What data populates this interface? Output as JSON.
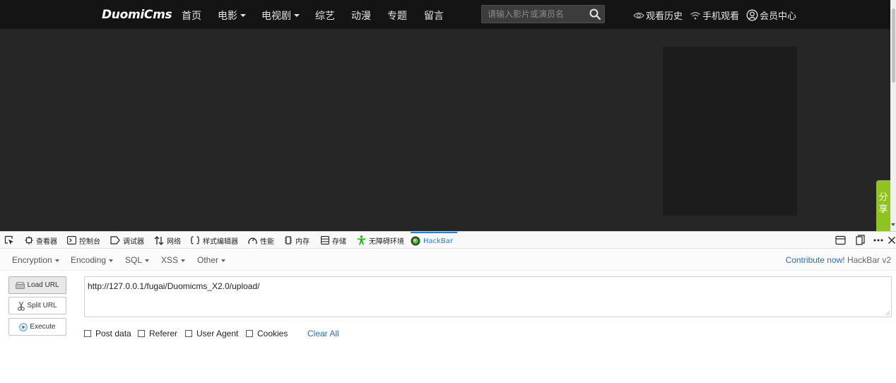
{
  "site": {
    "logo": "DuomiCms",
    "nav": [
      {
        "label": "首页",
        "dropdown": false
      },
      {
        "label": "电影",
        "dropdown": true
      },
      {
        "label": "电视剧",
        "dropdown": true
      },
      {
        "label": "综艺",
        "dropdown": false
      },
      {
        "label": "动漫",
        "dropdown": false
      },
      {
        "label": "专题",
        "dropdown": false
      },
      {
        "label": "留言",
        "dropdown": false
      }
    ],
    "search": {
      "placeholder": "请输入影片或演员名",
      "icon": "search-icon"
    },
    "right_links": [
      {
        "label": "观看历史",
        "icon": "eye-icon"
      },
      {
        "label": "手机观看",
        "icon": "wifi-icon"
      },
      {
        "label": "会员中心",
        "icon": "user-icon"
      }
    ],
    "share": {
      "label_1": "分",
      "label_2": "享"
    },
    "colors": {
      "topbar": "#141414",
      "body": "#262626",
      "share": "#8fc31f"
    }
  },
  "devtools": {
    "tabs": [
      {
        "label": "",
        "icon": "inspector-pick-icon"
      },
      {
        "label": "查看器",
        "icon": "inspector-icon"
      },
      {
        "label": "控制台",
        "icon": "console-icon"
      },
      {
        "label": "调试器",
        "icon": "debugger-icon"
      },
      {
        "label": "网络",
        "icon": "network-icon"
      },
      {
        "label": "样式编辑器",
        "icon": "style-editor-icon"
      },
      {
        "label": "性能",
        "icon": "performance-icon"
      },
      {
        "label": "内存",
        "icon": "memory-icon"
      },
      {
        "label": "存储",
        "icon": "storage-icon"
      },
      {
        "label": "无障碍环境",
        "icon": "accessibility-icon"
      },
      {
        "label": "HackBar",
        "icon": "hackbar-icon",
        "active": true
      }
    ],
    "right_icons": [
      "responsive-design-icon",
      "dock-side-icon",
      "more-options-icon",
      "close-icon"
    ]
  },
  "hackbar": {
    "menu": [
      {
        "label": "Encryption"
      },
      {
        "label": "Encoding"
      },
      {
        "label": "SQL"
      },
      {
        "label": "XSS"
      },
      {
        "label": "Other"
      }
    ],
    "contribute": "Contribute now!",
    "version": "HackBar v2",
    "buttons": {
      "load": "Load URL",
      "split": "Split URL",
      "execute": "Execute"
    },
    "url": "http://127.0.0.1/fugai/Duomicms_X2.0/upload/",
    "options": [
      {
        "label": "Post data",
        "checked": false
      },
      {
        "label": "Referer",
        "checked": false
      },
      {
        "label": "User Agent",
        "checked": false
      },
      {
        "label": "Cookies",
        "checked": false
      }
    ],
    "clear_all": "Clear All"
  }
}
